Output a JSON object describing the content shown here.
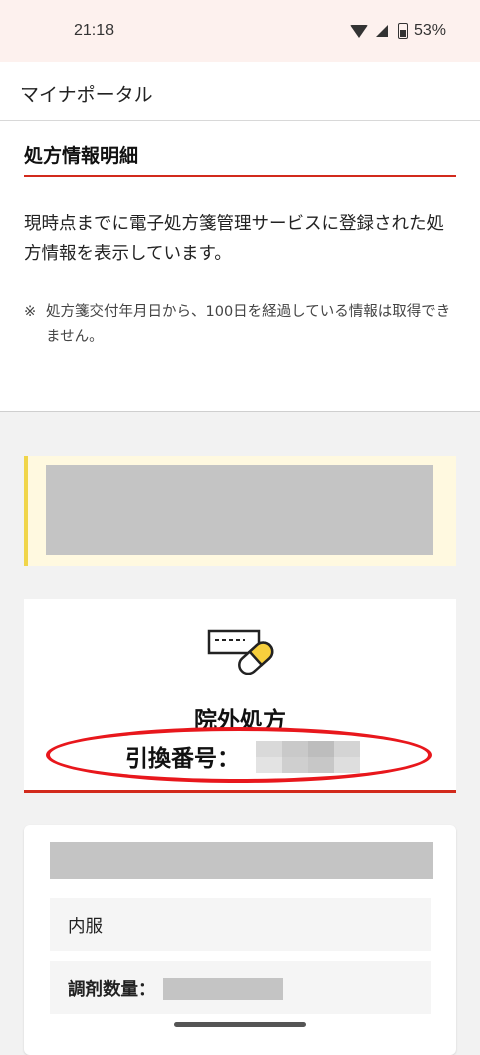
{
  "status_bar": {
    "time": "21:18",
    "battery": "53%"
  },
  "app_bar": {
    "title": "マイナポータル"
  },
  "info": {
    "heading": "処方情報明細",
    "description": "現時点までに電子処方箋管理サービスに登録された処方情報を表示しています。",
    "note_mark": "※",
    "note": "処方箋交付年月日から、100日を経過している情報は取得できません。"
  },
  "prescription": {
    "type": "院外処方",
    "exchange_label": "引換番号："
  },
  "detail": {
    "dosage_form": "内服",
    "quantity_label": "調剤数量："
  },
  "colors": {
    "accent_red": "#d22a1c",
    "highlight_red": "#e8171c",
    "alert_yellow": "#f0d54a"
  }
}
